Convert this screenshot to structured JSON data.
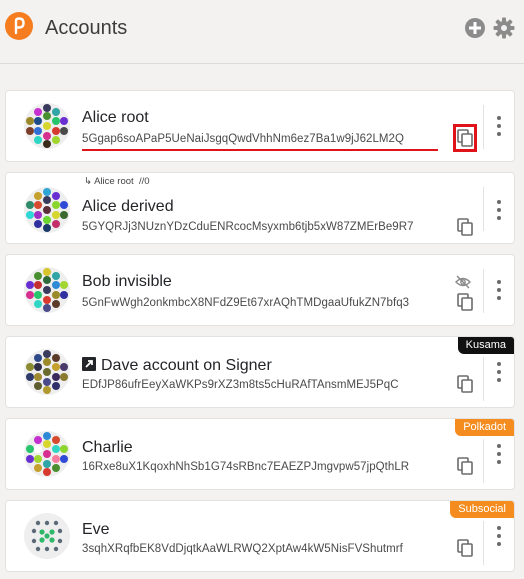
{
  "header": {
    "title": "Accounts",
    "logo_icon": "polkadot-logo-icon",
    "add_icon": "plus-circle-icon",
    "settings_icon": "gear-icon",
    "brand_color": "#f57c1f"
  },
  "accounts": [
    {
      "name": "Alice root",
      "address": "5Ggap6soAPaP5UeNaiJsgqQwdVhhNm6ez7Ba1w9jJ62LM2Q",
      "highlighted": true
    },
    {
      "name": "Alice derived",
      "address": "5GYQRJj3NUznYDzCduENRcocMsyxmb6tjb5xW87ZMErBe9R7",
      "parent_name": "Alice root",
      "derivation_path": "//0"
    },
    {
      "name": "Bob invisible",
      "address": "5GnFwWgh2onkmbcX8NFdZ9Et67xrAQhTMDgaaUfukZN7bfq3",
      "hidden": true
    },
    {
      "name": "Dave account on Signer",
      "address": "EDfJP86ufrEeyXaWKPs9rXZ3m8ts5cHuRAfTAnsmMEJ5PqC",
      "network_badge": "Kusama",
      "external": true
    },
    {
      "name": "Charlie",
      "address": "16Rxe8uX1KqoxhNhSb1G74sRBnc7EAEZPJmgvpw57jpQthLR",
      "network_badge": "Polkadot"
    },
    {
      "name": "Eve",
      "address": "3sqhXRqfbEK8VdDjqtkAaWLRWQ2XptAw4kW5NisFVShutmrf",
      "network_badge": "Subsocial"
    }
  ],
  "colors": {
    "highlight_red": "#e0131a",
    "kusama_badge": "#111111",
    "polkadot_badge": "#f58c1f",
    "subsocial_badge": "#f58c1f"
  }
}
